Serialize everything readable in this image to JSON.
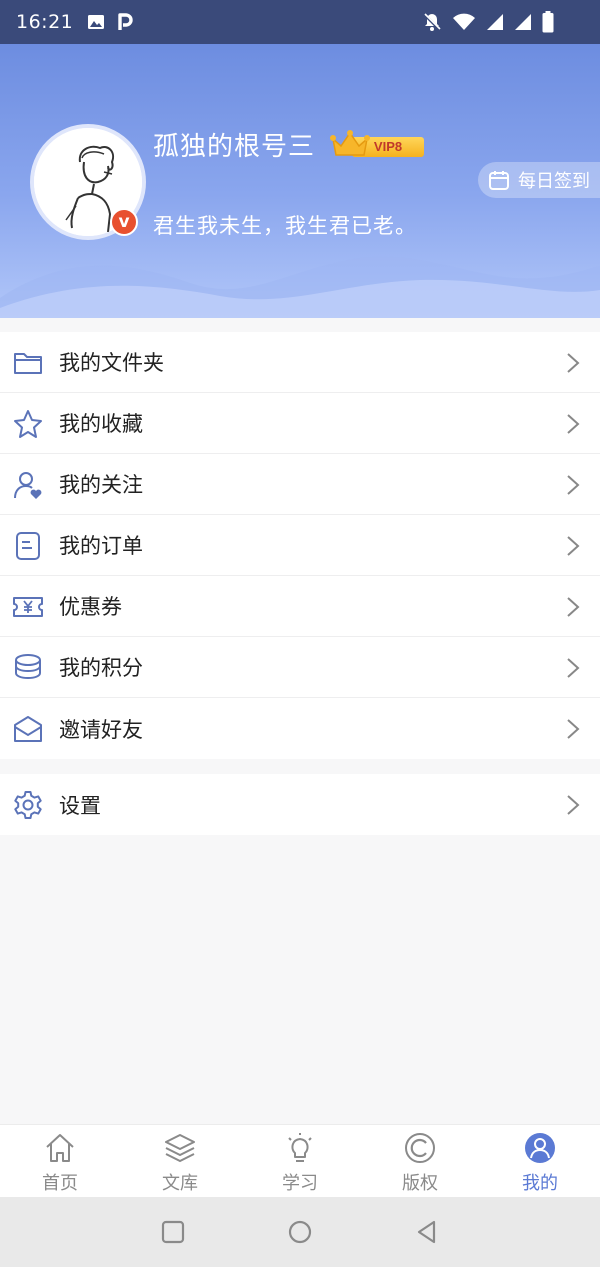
{
  "status_bar": {
    "time": "16:21"
  },
  "profile": {
    "username": "孤独的根号三",
    "vip_level": "VIP8",
    "verified_mark": "v",
    "motto": "君生我未生，我生君已老。",
    "checkin_label": "每日签到"
  },
  "menu": {
    "items": [
      {
        "label": "我的文件夹",
        "icon": "folder-icon"
      },
      {
        "label": "我的收藏",
        "icon": "star-icon"
      },
      {
        "label": "我的关注",
        "icon": "user-heart-icon"
      },
      {
        "label": "我的订单",
        "icon": "order-icon"
      },
      {
        "label": "优惠券",
        "icon": "coupon-icon"
      },
      {
        "label": "我的积分",
        "icon": "coins-icon"
      },
      {
        "label": "邀请好友",
        "icon": "mail-icon"
      }
    ],
    "settings": {
      "label": "设置",
      "icon": "gear-icon"
    }
  },
  "bottom_nav": {
    "items": [
      {
        "label": "首页",
        "icon": "home-icon"
      },
      {
        "label": "文库",
        "icon": "layers-icon"
      },
      {
        "label": "学习",
        "icon": "bulb-icon"
      },
      {
        "label": "版权",
        "icon": "copyright-icon"
      },
      {
        "label": "我的",
        "icon": "profile-icon",
        "active": true
      }
    ]
  },
  "colors": {
    "accent": "#5b7ad4",
    "header_top": "#6d8de0",
    "header_bottom": "#b2c7f9",
    "icon_stroke": "#5b73b8",
    "vip_gold": "#f5b21f",
    "badge_red": "#e8502f"
  }
}
